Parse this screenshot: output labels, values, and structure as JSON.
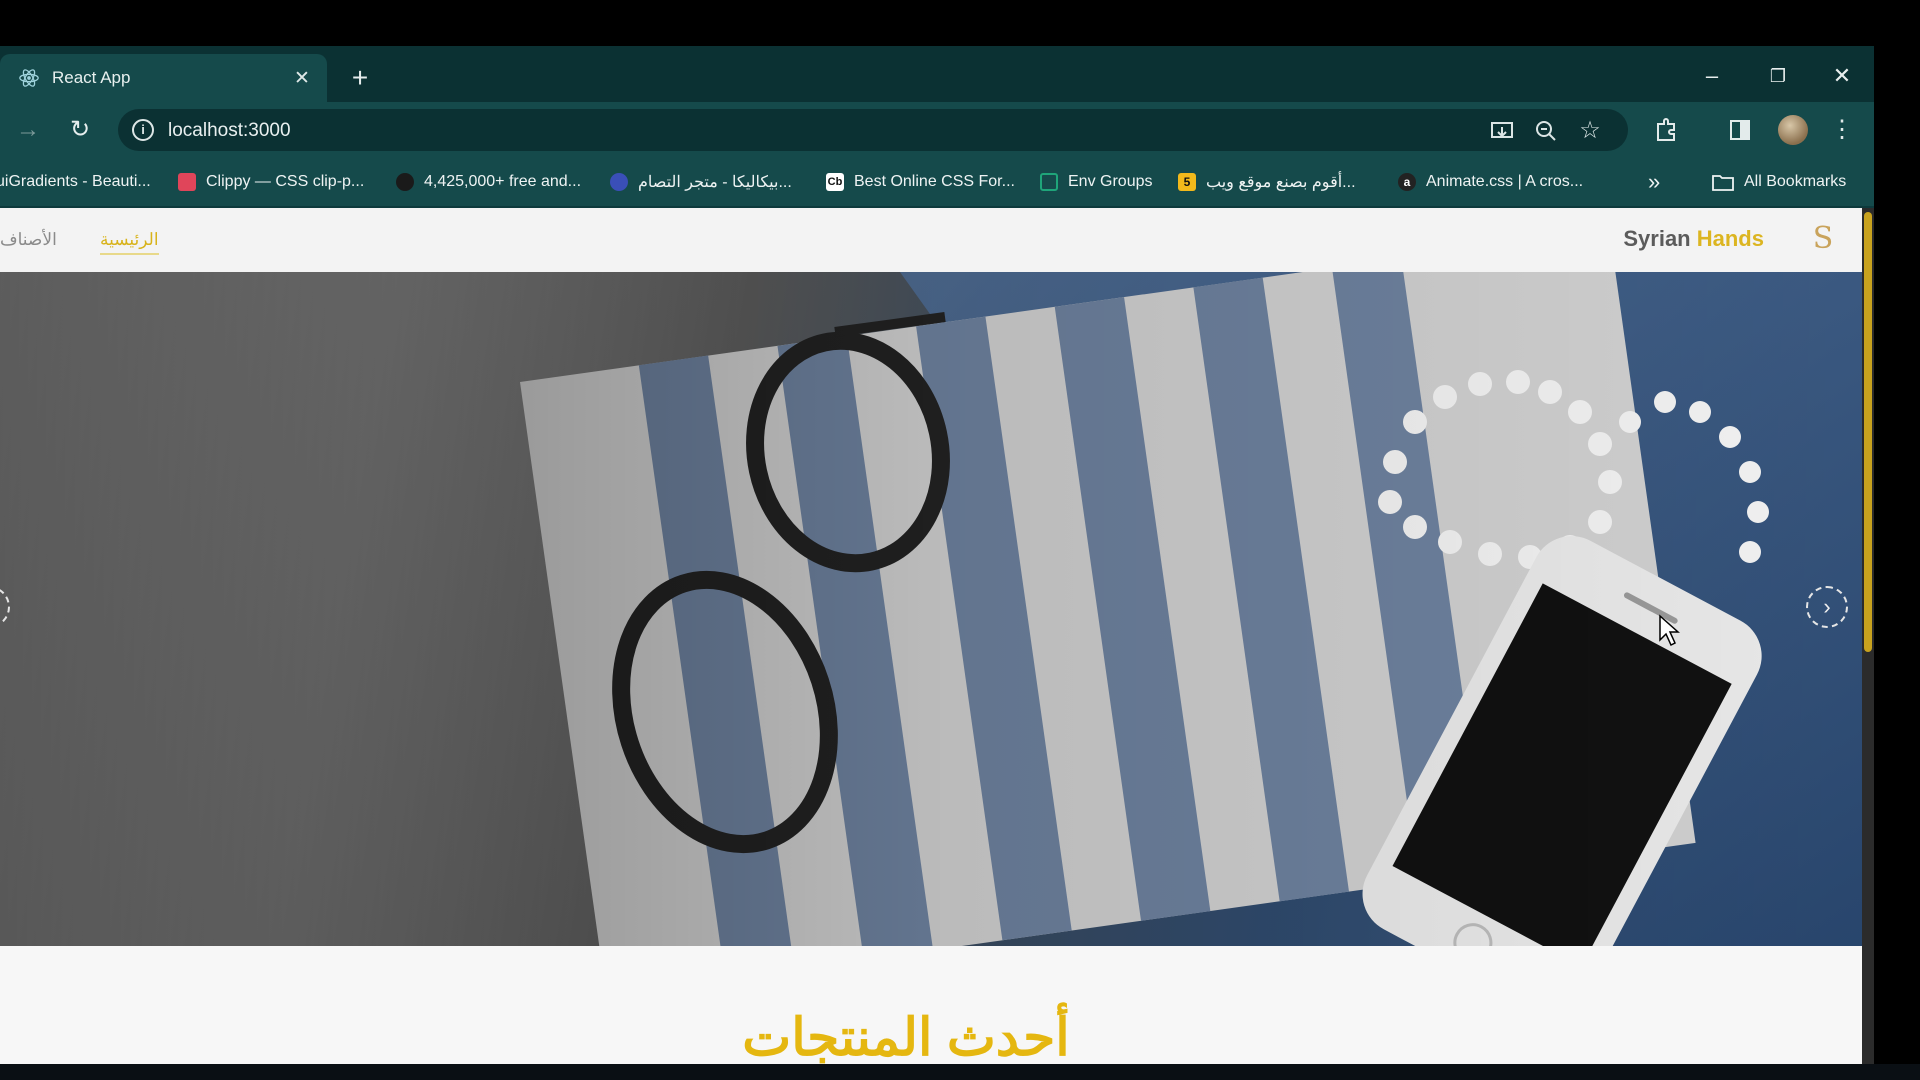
{
  "browser": {
    "tab": {
      "title": "React App",
      "close": "✕"
    },
    "new_tab": "+",
    "window_controls": {
      "minimize": "–",
      "restore": "❐",
      "close": "✕"
    },
    "nav": {
      "forward": "→",
      "reload": "↻"
    },
    "url": "localhost:3000",
    "bookmarks": [
      {
        "label": "uiGradients - Beauti...",
        "icon_color": "#ffffff"
      },
      {
        "label": "Clippy — CSS clip-p...",
        "icon_color": "#e0455a"
      },
      {
        "label": "4,425,000+ free and...",
        "icon_color": "#1a1a1a"
      },
      {
        "label": "بيكاليكا - متجر التصام...",
        "icon_color": "#3a4fb8"
      },
      {
        "label": "Best Online CSS For...",
        "icon_color": "#ffffff",
        "icon_text": "Cb"
      },
      {
        "label": "Env Groups",
        "icon_color": "#1fa57a"
      },
      {
        "label": "أقوم بصنع موقع ويب...",
        "icon_color": "#f2b91b",
        "icon_text": "5"
      },
      {
        "label": "Animate.css | A cros...",
        "icon_color": "#222222",
        "icon_text": "a"
      }
    ],
    "more_bookmarks": "»",
    "all_bookmarks": "All Bookmarks"
  },
  "site": {
    "nav_categories": "الأصناف",
    "nav_home": "الرئيسية",
    "brand_part1": "Syrian",
    "brand_part2": "Hands",
    "brand_logo": "S",
    "carousel_next": "›",
    "section_title": "أحدث المنتجات",
    "accent_color": "#dcb521"
  }
}
